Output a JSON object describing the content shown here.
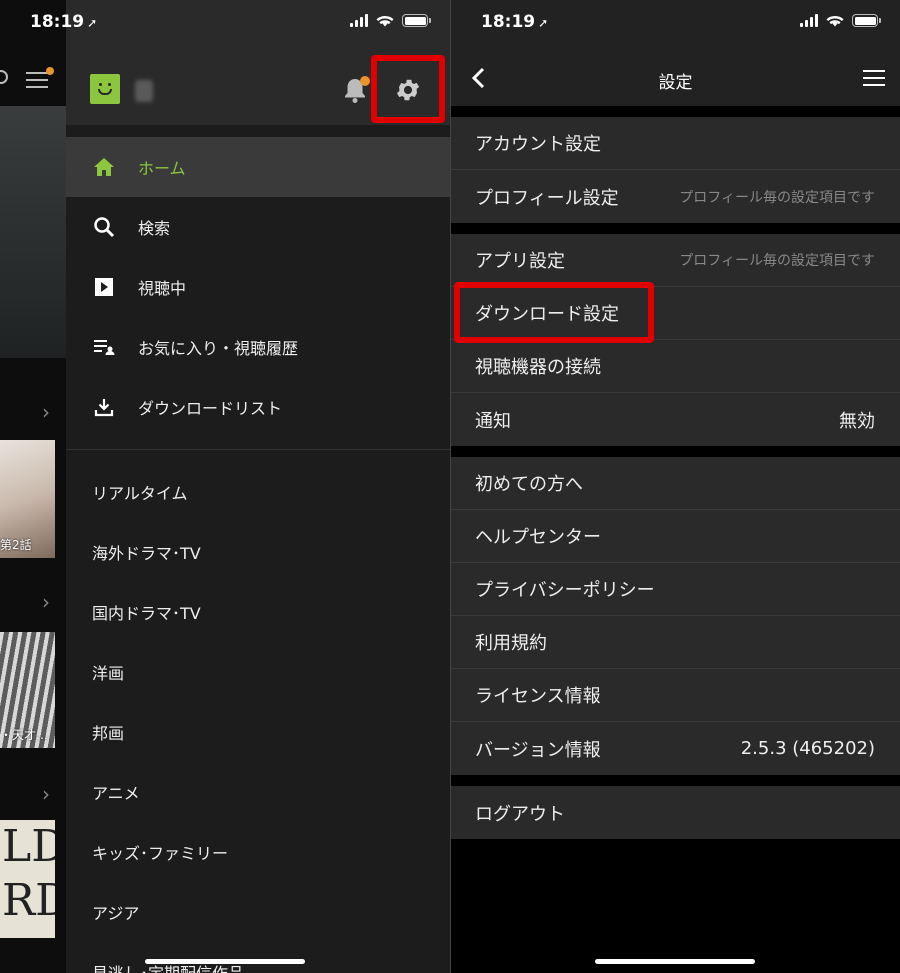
{
  "status_bar": {
    "time": "18:19"
  },
  "background_app": {
    "thumb1_caption": "第2話",
    "thumb2_caption": "・天才…",
    "thumb3_text": "LD\nRD"
  },
  "drawer": {
    "menu_items": [
      {
        "label": "ホーム",
        "icon": "home-icon",
        "active": true
      },
      {
        "label": "検索",
        "icon": "search-icon"
      },
      {
        "label": "視聴中",
        "icon": "play-icon"
      },
      {
        "label": "お気に入り・視聴履歴",
        "icon": "favorites-list-icon"
      },
      {
        "label": "ダウンロードリスト",
        "icon": "download-icon"
      }
    ],
    "categories": [
      "リアルタイム",
      "海外ドラマ･TV",
      "国内ドラマ･TV",
      "洋画",
      "邦画",
      "アニメ",
      "キッズ･ファミリー",
      "アジア",
      "見逃し･定期配信作品"
    ]
  },
  "settings": {
    "title": "設定",
    "group1": [
      {
        "label": "アカウント設定",
        "sub": ""
      },
      {
        "label": "プロフィール設定",
        "sub": "プロフィール毎の設定項目です"
      }
    ],
    "group2": [
      {
        "label": "アプリ設定",
        "sub": "プロフィール毎の設定項目です"
      },
      {
        "label": "ダウンロード設定",
        "sub": ""
      },
      {
        "label": "視聴機器の接続",
        "sub": ""
      },
      {
        "label": "通知",
        "value": "無効"
      }
    ],
    "group3": [
      {
        "label": "初めての方へ"
      },
      {
        "label": "ヘルプセンター"
      },
      {
        "label": "プライバシーポリシー"
      },
      {
        "label": "利用規約"
      },
      {
        "label": "ライセンス情報"
      },
      {
        "label": "バージョン情報",
        "value": "2.5.3 (465202)"
      }
    ],
    "group4": [
      {
        "label": "ログアウト"
      }
    ]
  },
  "colors": {
    "accent": "#8cc63f",
    "highlight": "#e00000",
    "notification": "#e8952c"
  }
}
